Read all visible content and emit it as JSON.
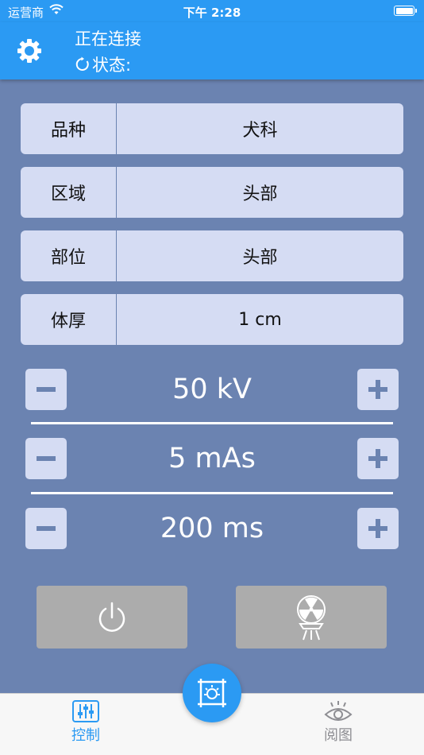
{
  "status_bar": {
    "carrier": "运营商",
    "time": "下午 2:28"
  },
  "header": {
    "title": "正在连接",
    "status_label": "状态:"
  },
  "fields": [
    {
      "label": "品种",
      "value": "犬科"
    },
    {
      "label": "区域",
      "value": "头部"
    },
    {
      "label": "部位",
      "value": "头部"
    },
    {
      "label": "体厚",
      "value": "1 cm"
    }
  ],
  "steppers": [
    {
      "value": "50 kV"
    },
    {
      "value": "5 mAs"
    },
    {
      "value": "200 ms"
    }
  ],
  "tabs": {
    "control_label": "控制",
    "view_label": "阅图"
  },
  "icons": {
    "settings": "gear-icon",
    "status": "refresh-icon",
    "power": "power-icon",
    "exposure": "radiation-icon",
    "capture": "capture-icon",
    "control": "sliders-icon",
    "view": "eye-icon"
  },
  "colors": {
    "primary": "#2b9af3",
    "background": "#6b83b1",
    "field_bg": "#d5dcf3",
    "button_disabled": "#acacac",
    "stepper_icon": "#6b83b1"
  }
}
